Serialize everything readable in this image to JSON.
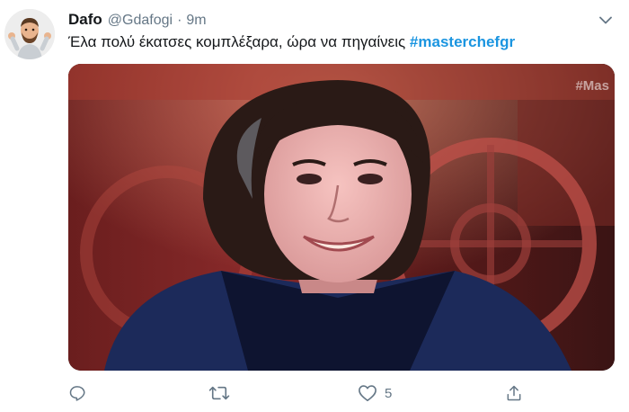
{
  "tweet": {
    "author": {
      "name": "Dafo",
      "handle": "@Gdafogi",
      "avatar_icon": "memoji-avatar-shrug-icon"
    },
    "separator": "·",
    "time": "9m",
    "text": "Έλα πολύ έκατσες κομπλέξαρα, ώρα να πηγαίνεις",
    "hashtag": "#masterchefgr",
    "media": {
      "overlay_text": "#Mas",
      "description_icon": "photo-woman-smiling"
    },
    "actions": {
      "reply": {
        "icon": "reply-icon"
      },
      "retweet": {
        "icon": "retweet-icon"
      },
      "like": {
        "icon": "heart-icon",
        "count": "5"
      },
      "share": {
        "icon": "share-icon"
      }
    },
    "menu": {
      "icon": "chevron-down-icon"
    }
  },
  "colors": {
    "link": "#1b95e0",
    "secondary_text": "#657786",
    "primary_text": "#14171a"
  }
}
